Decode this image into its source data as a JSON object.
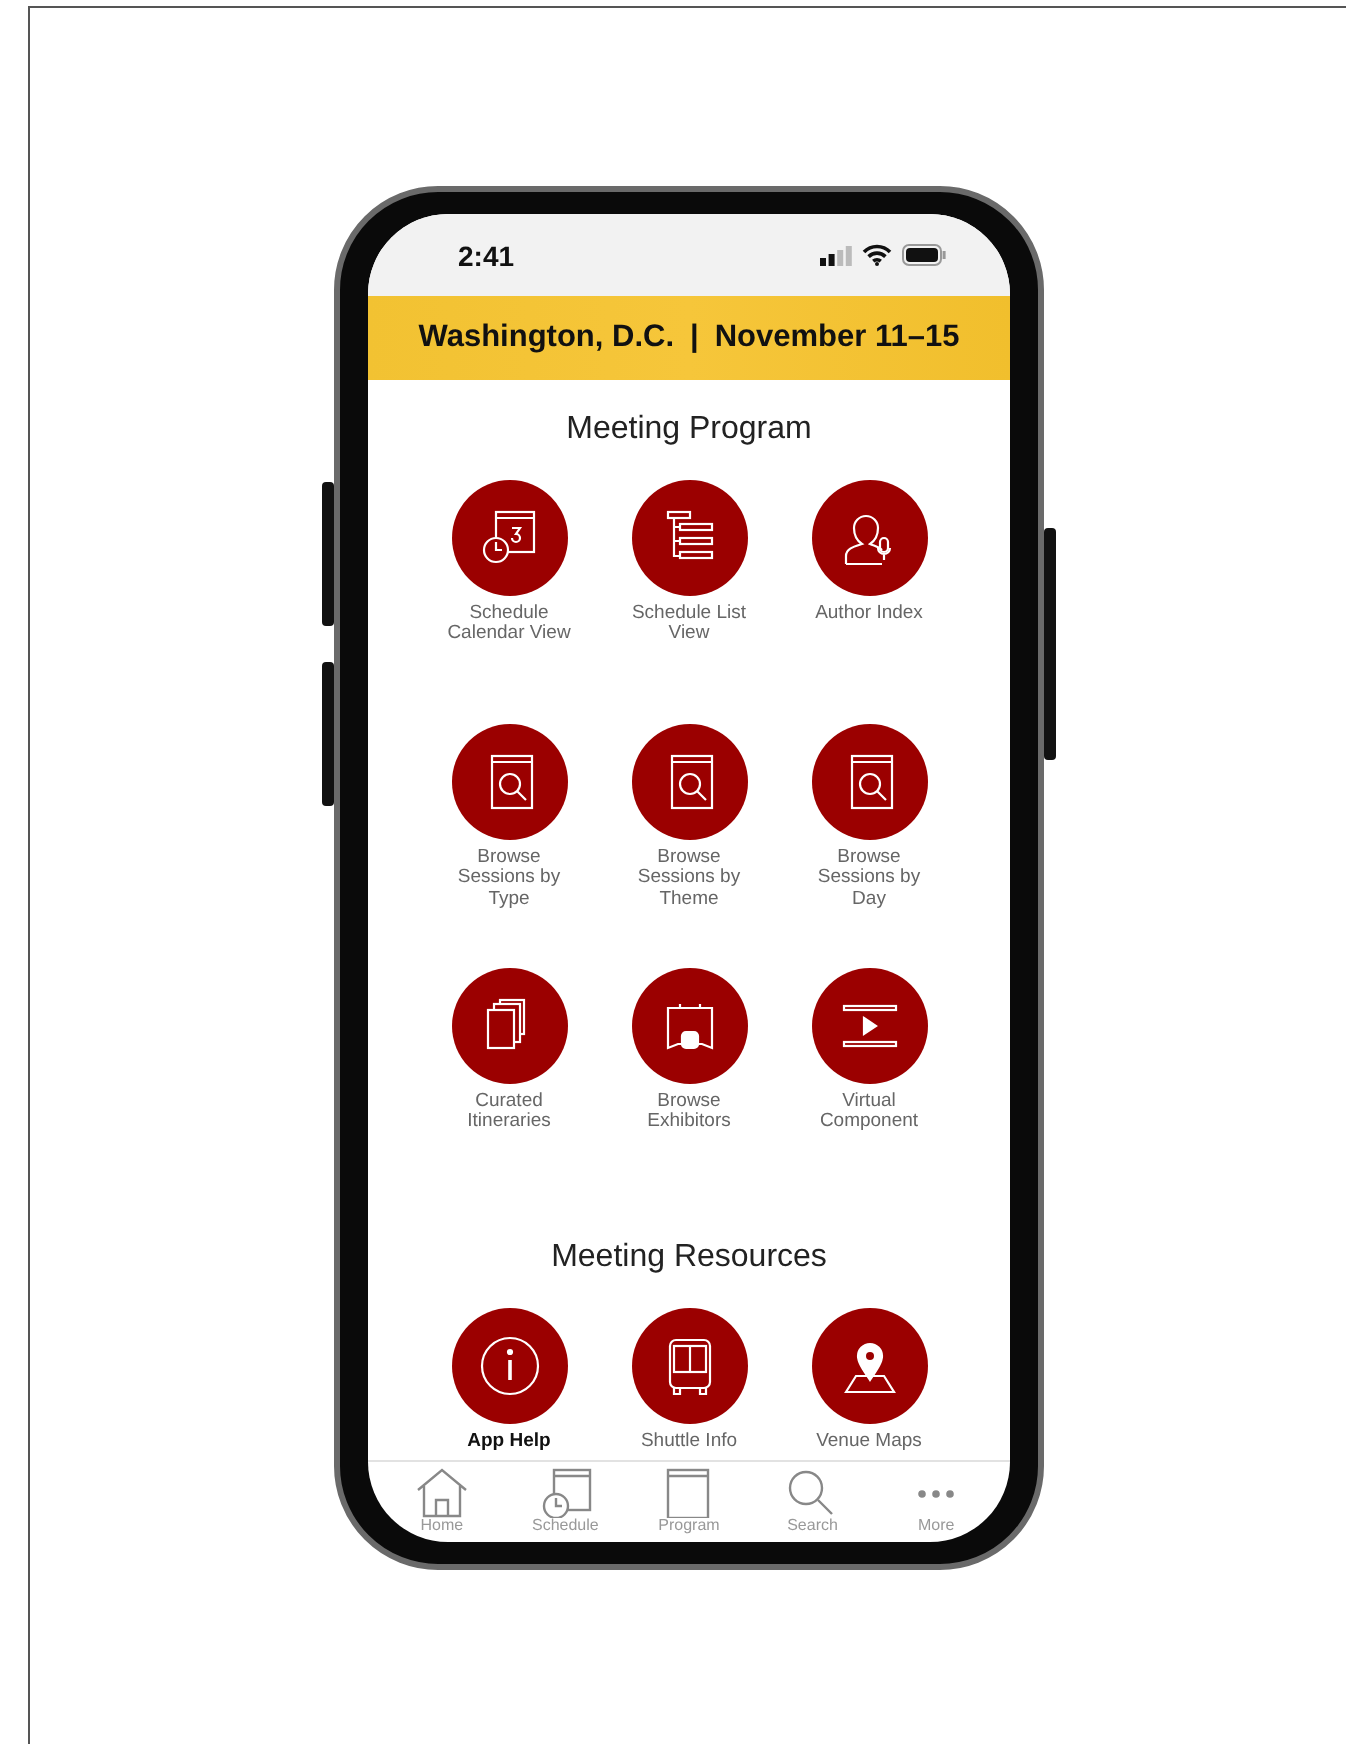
{
  "status_bar": {
    "time": "2:41"
  },
  "banner": {
    "location": "Washington, D.C.",
    "separator": "|",
    "dates": "November 11–15"
  },
  "sections": [
    {
      "title": "Meeting Program",
      "items": [
        {
          "label": "Schedule Calendar View",
          "kind": "calendar",
          "selected": false
        },
        {
          "label": "Schedule List View",
          "kind": "list",
          "selected": false
        },
        {
          "label": "Author Index",
          "kind": "author",
          "selected": false
        },
        {
          "label": "Browse Sessions by Type",
          "kind": "browse",
          "selected": false
        },
        {
          "label": "Browse Sessions by Theme",
          "kind": "browse",
          "selected": false
        },
        {
          "label": "Browse Sessions by Day",
          "kind": "browse",
          "selected": false
        },
        {
          "label": "Curated Itineraries",
          "kind": "pages",
          "selected": false
        },
        {
          "label": "Browse Exhibitors",
          "kind": "booth",
          "selected": false
        },
        {
          "label": "Virtual Component",
          "kind": "video",
          "selected": false
        }
      ]
    },
    {
      "title": "Meeting Resources",
      "items": [
        {
          "label": "App Help",
          "kind": "info",
          "selected": true
        },
        {
          "label": "Shuttle Info",
          "kind": "bus",
          "selected": false
        },
        {
          "label": "Venue Maps",
          "kind": "map",
          "selected": false
        }
      ]
    }
  ],
  "tab_bar": [
    {
      "label": "Home",
      "kind": "home"
    },
    {
      "label": "Schedule",
      "kind": "calendar"
    },
    {
      "label": "Program",
      "kind": "book"
    },
    {
      "label": "Search",
      "kind": "search"
    },
    {
      "label": "More",
      "kind": "more"
    }
  ]
}
